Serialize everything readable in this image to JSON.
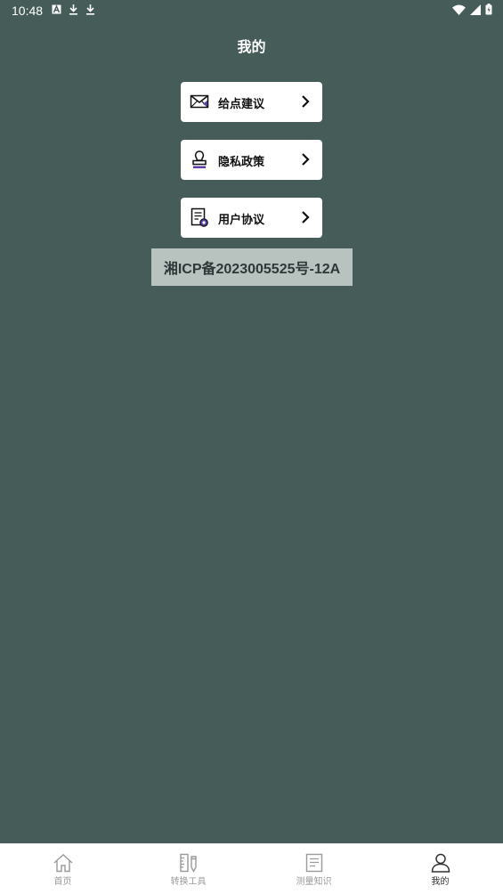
{
  "status_bar": {
    "time": "10:48"
  },
  "header": {
    "title": "我的"
  },
  "menu": {
    "items": [
      {
        "label": "给点建议",
        "icon": "mail-icon"
      },
      {
        "label": "隐私政策",
        "icon": "stamp-icon"
      },
      {
        "label": "用户协议",
        "icon": "document-icon"
      }
    ]
  },
  "icp": {
    "text": "湘ICP备2023005525号-12A"
  },
  "tab_bar": {
    "tabs": [
      {
        "label": "首页",
        "icon": "home-icon",
        "active": false
      },
      {
        "label": "转换工具",
        "icon": "ruler-pencil-icon",
        "active": false
      },
      {
        "label": "测量知识",
        "icon": "notes-icon",
        "active": false
      },
      {
        "label": "我的",
        "icon": "user-icon",
        "active": true
      }
    ]
  },
  "colors": {
    "background": "#455c58",
    "card": "#ffffff",
    "icp_background": "#b8c2bf",
    "accent": "#5a3fa8"
  }
}
